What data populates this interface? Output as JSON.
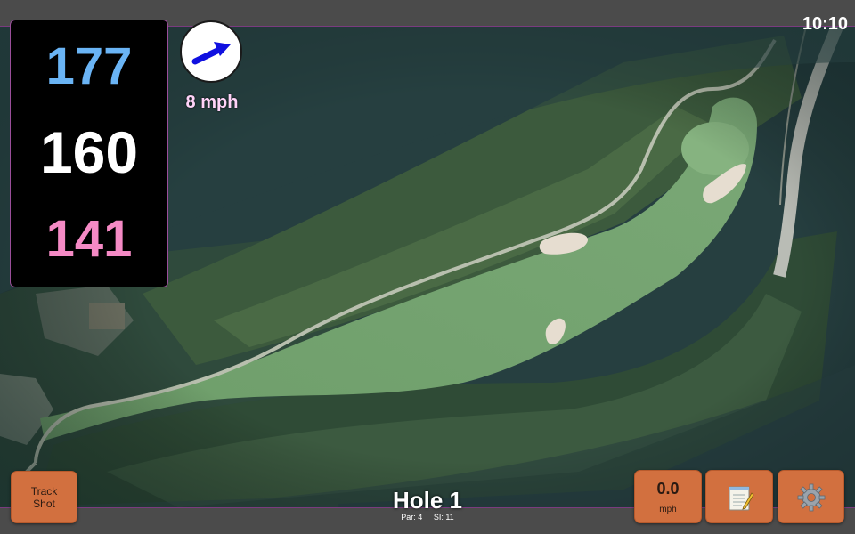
{
  "status": {
    "clock": "10:10"
  },
  "distances": {
    "back": "177",
    "middle": "160",
    "front": "141"
  },
  "wind": {
    "speed": "8 mph",
    "direction_icon": "wind-arrow-icon"
  },
  "hole": {
    "title": "Hole 1",
    "par_label": "Par: 4",
    "si_label": "SI: 11"
  },
  "buttons": {
    "track_shot": "Track Shot",
    "speed_value": "0.0",
    "speed_unit": "mph",
    "notes_icon": "notepad-icon",
    "settings_icon": "gear-icon"
  },
  "colors": {
    "back_distance": "#6ab4f5",
    "middle_distance": "#ffffff",
    "front_distance": "#f58ac5",
    "button": "#d2703f",
    "accent_border": "#9a4e9a",
    "wind_arrow": "#1010e0"
  }
}
